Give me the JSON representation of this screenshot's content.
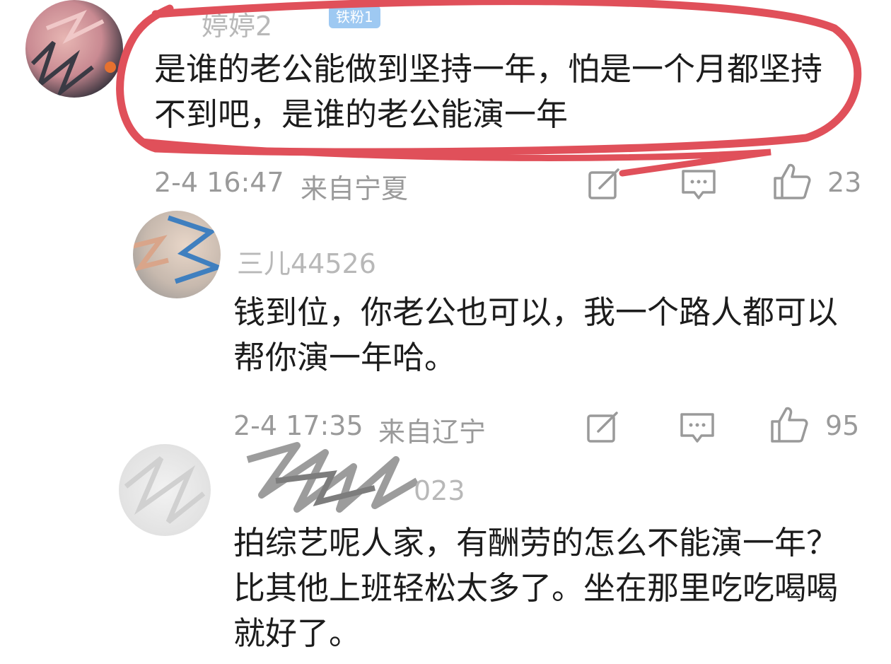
{
  "comments": [
    {
      "username": "婷婷2",
      "badge": "铁粉1",
      "text": "是谁的老公能做到坚持一年，怕是一个月都坚持不到吧，是谁的老公能演一年",
      "time": "2-4 16:47",
      "location": "来自宁夏",
      "likes": "23"
    },
    {
      "username": "三儿44526",
      "text": "钱到位，你老公也可以，我一个路人都可以帮你演一年哈。",
      "time": "2-4 17:35",
      "location": "来自辽宁",
      "likes": "95"
    },
    {
      "username": "023",
      "text": "拍综艺呢人家，有酬劳的怎么不能演一年？比其他上班轻松太多了。坐在那里吃吃喝喝就好了。"
    }
  ],
  "icons": [
    "share-icon",
    "reply-icon",
    "like-icon"
  ],
  "colors": {
    "highlight": "#e0505a",
    "meta": "#9a9a9a",
    "badge": "#9ec9f2"
  }
}
